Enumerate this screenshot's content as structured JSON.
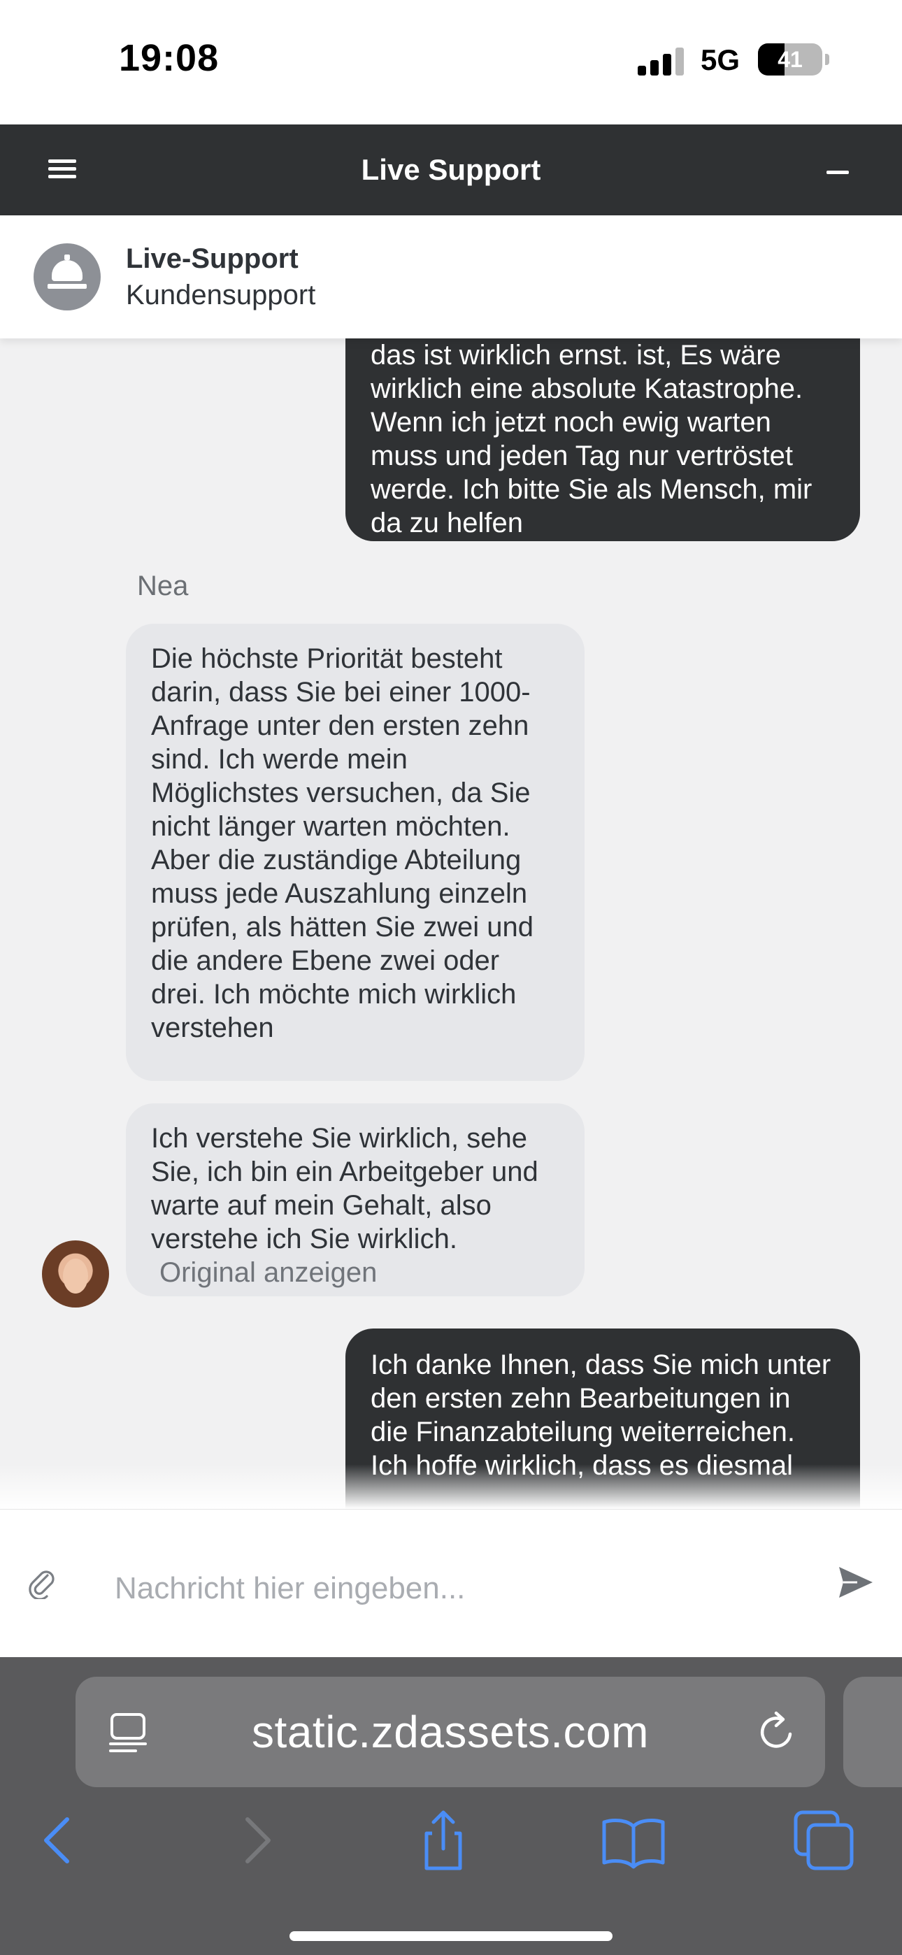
{
  "status_bar": {
    "time": "19:08",
    "network": "5G",
    "battery": "41",
    "battery_level": 0.41
  },
  "header": {
    "title": "Live Support",
    "menu_icon": "hamburger-icon",
    "minimize_icon": "minimize-icon"
  },
  "agent": {
    "name": "Live-Support",
    "department": "Kundensupport",
    "avatar_icon": "service-bell-icon"
  },
  "messages": [
    {
      "direction": "outgoing",
      "text": "das ist wirklich ernst. ist, Es wäre wirklich eine absolute Katastrophe. Wenn ich jetzt noch ewig warten muss und jeden Tag nur vertröstet werde. Ich bitte Sie als Mensch, mir da zu helfen"
    },
    {
      "direction": "incoming",
      "sender": "Nea",
      "text": "Die höchste Priorität besteht darin, dass Sie bei einer 1000-Anfrage unter den ersten zehn sind. Ich werde mein Möglichstes versuchen, da Sie nicht länger warten möchten. Aber die zuständige Abteilung muss jede Auszahlung einzeln prüfen, als hätten Sie zwei und die andere Ebene zwei oder drei. Ich möchte mich wirklich verstehen"
    },
    {
      "direction": "incoming",
      "text": "Ich verstehe Sie wirklich, sehe Sie, ich bin ein Arbeitgeber und warte auf mein Gehalt, also verstehe ich Sie wirklich.",
      "link": "Original anzeigen"
    },
    {
      "direction": "outgoing",
      "text": "Ich danke Ihnen, dass Sie mich unter den ersten zehn Bearbeitungen in die Finanzabteilung weiterreichen. Ich hoffe wirklich, dass es diesmal"
    }
  ],
  "composer": {
    "placeholder": "Nachricht hier eingeben...",
    "attach_icon": "paperclip-icon",
    "send_icon": "send-icon"
  },
  "browser": {
    "url": "static.zdassets.com"
  },
  "colors": {
    "header_bg": "#2f3133",
    "outgoing_bubble": "#2f3133",
    "incoming_bubble": "#e6e7ea",
    "chat_bg": "#f1f1f2",
    "toolbar_accent": "#4a8df6"
  }
}
